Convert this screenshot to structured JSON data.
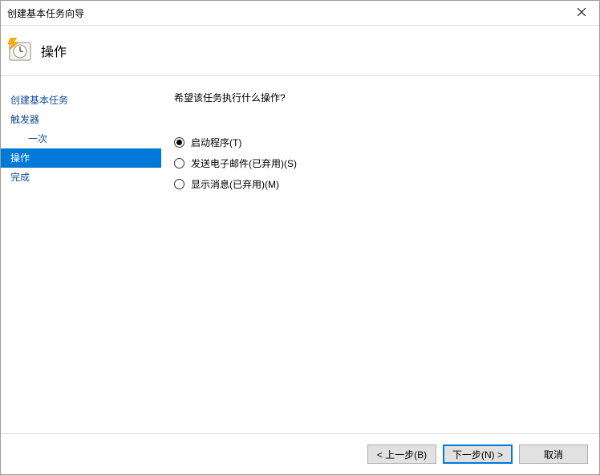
{
  "window": {
    "title": "创建基本任务向导"
  },
  "header": {
    "title": "操作"
  },
  "sidebar": {
    "items": [
      {
        "label": "创建基本任务",
        "sub": false,
        "current": false
      },
      {
        "label": "触发器",
        "sub": false,
        "current": false
      },
      {
        "label": "一次",
        "sub": true,
        "current": false
      },
      {
        "label": "操作",
        "sub": false,
        "current": true
      },
      {
        "label": "完成",
        "sub": false,
        "current": false
      }
    ]
  },
  "main": {
    "prompt": "希望该任务执行什么操作?",
    "options": [
      {
        "label": "启动程序(T)",
        "checked": true
      },
      {
        "label": "发送电子邮件(已弃用)(S)",
        "checked": false
      },
      {
        "label": "显示消息(已弃用)(M)",
        "checked": false
      }
    ]
  },
  "footer": {
    "back": "< 上一步(B)",
    "next": "下一步(N) >",
    "cancel": "取消"
  }
}
